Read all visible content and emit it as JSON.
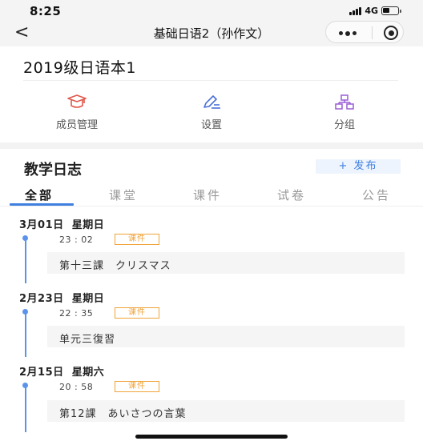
{
  "status_bar": {
    "time": "8:25",
    "network": "4G"
  },
  "nav": {
    "back_icon": "chevron-left-icon",
    "back_glyph": "<",
    "title": "基础日语2（孙作文）",
    "more_icon": "more-dots-icon",
    "close_icon": "target-circle-icon"
  },
  "class_name": "2019级日语本1",
  "menu": [
    {
      "label": "成员管理",
      "icon": "graduation-cap-icon",
      "color": "#e0584a"
    },
    {
      "label": "设置",
      "icon": "pencil-ruler-icon",
      "color": "#4a6fd8"
    },
    {
      "label": "分组",
      "icon": "group-tree-icon",
      "color": "#9a5dd6"
    }
  ],
  "section_title": "教学日志",
  "publish_button": "+ 发布",
  "tabs": [
    {
      "label": "全部",
      "active": true
    },
    {
      "label": "课堂",
      "active": false
    },
    {
      "label": "课件",
      "active": false
    },
    {
      "label": "试卷",
      "active": false
    },
    {
      "label": "公告",
      "active": false
    }
  ],
  "log_entries": [
    {
      "date": "3月01日",
      "weekday": "星期日",
      "time": "23 : 02",
      "tag": "课件",
      "title": "第十三課　クリスマス"
    },
    {
      "date": "2月23日",
      "weekday": "星期日",
      "time": "22 : 35",
      "tag": "课件",
      "title": "单元三復習"
    },
    {
      "date": "2月15日",
      "weekday": "星期六",
      "time": "20 : 58",
      "tag": "课件",
      "title": "第12課　あいさつの言葉"
    }
  ],
  "colors": {
    "accent_blue": "#3f7fe0",
    "tag_orange": "#f0a43a",
    "timeline_blue": "#5b93ec"
  }
}
